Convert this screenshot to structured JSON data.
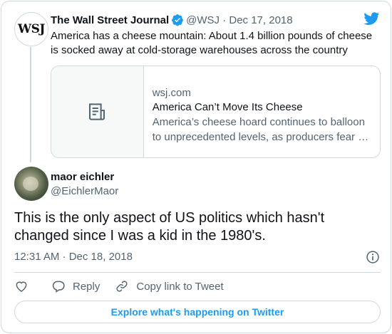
{
  "parent_tweet": {
    "avatar_text": "WSJ",
    "name": "The Wall Street Journal",
    "handle_date": "@WSJ · Dec 17, 2018",
    "text": "America has a cheese mountain: About 1.4 billion pounds of cheese is socked away at cold-storage warehouses across the country",
    "link_card": {
      "domain": "wsj.com",
      "title": "America Can’t Move Its Cheese",
      "description_line1": "America’s cheese hoard continues to balloon",
      "description_line2": "to unprecedented levels, as producers fear …"
    }
  },
  "main_tweet": {
    "name": "maor eichler",
    "handle": "@EichlerMaor",
    "text": "This is the only aspect of US politics which hasn't changed since I was a kid in the 1980's.",
    "timestamp": "12:31 AM · Dec 18, 2018"
  },
  "actions": {
    "reply_label": "Reply",
    "copy_link_label": "Copy link to Tweet"
  },
  "explore_label": "Explore what's happening on Twitter",
  "colors": {
    "twitter_blue": "#1d9bf0",
    "text_primary": "#0f1419",
    "text_secondary": "#536471",
    "border": "#cfd9de"
  },
  "icons": [
    "twitter-bird-icon",
    "verified-badge-icon",
    "article-icon",
    "info-icon",
    "heart-icon",
    "reply-icon",
    "link-icon"
  ]
}
